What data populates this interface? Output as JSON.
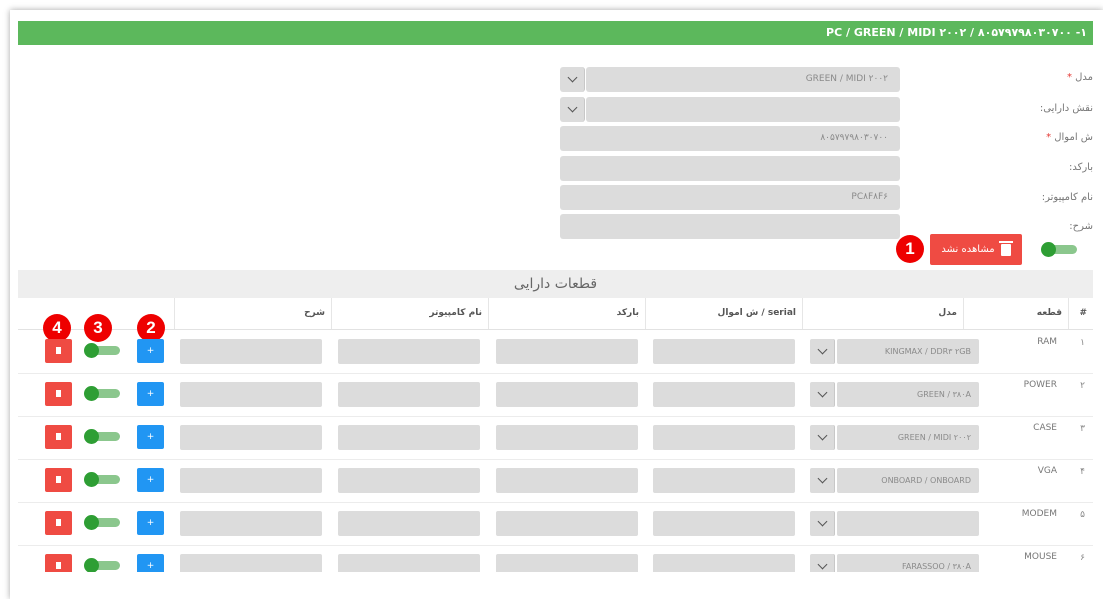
{
  "header": {
    "title": "PC / GREEN / MIDI ۲۰۰۲ / ۸۰۵۷۹۷۹۸۰۳۰۷۰۰ -۱"
  },
  "form": {
    "model": {
      "label": "مدل",
      "required": "*",
      "value": "GREEN / MIDI ۲۰۰۲"
    },
    "asset_role": {
      "label": "نقش دارایی:",
      "value": ""
    },
    "property_no": {
      "label": "ش اموال",
      "required": "*",
      "value": "۸۰۵۷۹۷۹۸۰۳۰۷۰۰"
    },
    "barcode": {
      "label": "بارکد:",
      "value": ""
    },
    "computer_name": {
      "label": "نام کامپیوتر:",
      "value": "PC۸F۸F۶"
    },
    "description": {
      "label": "شرح:",
      "value": ""
    },
    "active": true,
    "delete_button_label": "مشاهده نشد"
  },
  "badges": [
    "1",
    "2",
    "3",
    "4"
  ],
  "parts": {
    "title": "قطعات دارایی",
    "columns": {
      "index": "#",
      "part": "قطعه",
      "model": "مدل",
      "serial": "serial / ش اموال",
      "barcode": "بارکد",
      "computer_name": "نام کامپیوتر",
      "description": "شرح"
    },
    "rows": [
      {
        "index": "۱",
        "part": "RAM",
        "model": "KINGMAX / DDR۳ ۲GB",
        "add_label": "+"
      },
      {
        "index": "۲",
        "part": "POWER",
        "model": "GREEN / ۳۸۰A",
        "add_label": "+"
      },
      {
        "index": "۳",
        "part": "CASE",
        "model": "GREEN / MIDI ۲۰۰۲",
        "add_label": "+"
      },
      {
        "index": "۴",
        "part": "VGA",
        "model": "ONBOARD / ONBOARD",
        "add_label": "+"
      },
      {
        "index": "۵",
        "part": "MODEM",
        "model": "",
        "add_label": "+"
      },
      {
        "index": "۶",
        "part": "MOUSE",
        "model": "FARASSOO / ۳۸۰A",
        "add_label": "+"
      }
    ]
  },
  "colors": {
    "header_bar": "#5cb85c",
    "danger": "#ef4b43",
    "primary": "#2196f3",
    "toggle_on": "#2e9e34",
    "badge": "#ee0000"
  },
  "icons": [
    "chevron-down-icon",
    "trash-icon",
    "plus-icon"
  ]
}
